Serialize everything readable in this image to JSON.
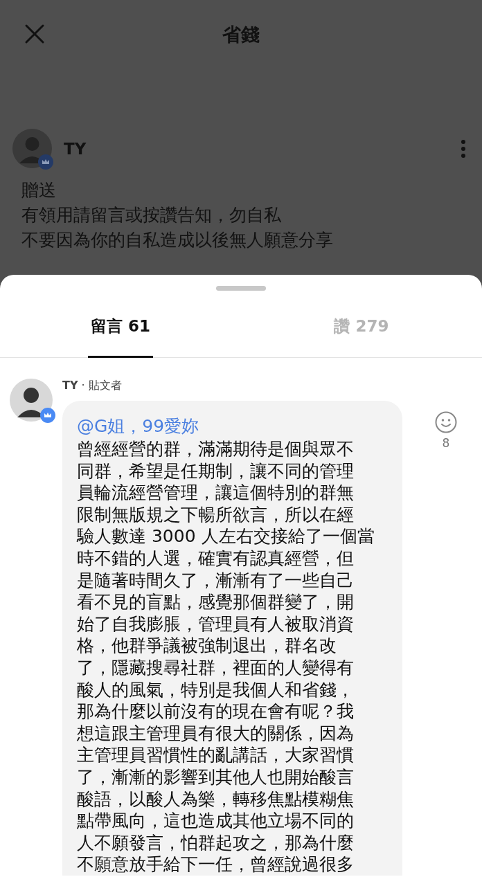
{
  "header": {
    "title": "省錢"
  },
  "post": {
    "author": "TY",
    "lines": [
      "贈送",
      "有領用請留言或按讚告知，勿自私",
      "不要因為你的自私造成以後無人願意分享"
    ]
  },
  "tabs": [
    {
      "label": "留言 61",
      "selected": true
    },
    {
      "label": "讚 279",
      "selected": false
    }
  ],
  "comments": [
    {
      "author_line": "**TY** · 貼文者",
      "mention": "@G姐，99愛妳",
      "lines": [
        "曾經經營的群，滿滿期待是個與眾不",
        "同群，希望是任期制，讓不同的管理",
        "員輪流經營管理，讓這個特別的群無",
        "限制無版規之下暢所欲言，所以在經",
        "驗人數達 3000 人左右交接給了一個當",
        "時不錯的人選，確實有認真經營，但",
        "是隨著時間久了，漸漸有了一些自己",
        "看不見的盲點，感覺那個群變了，開",
        "始了自我膨脹，管理員有人被取消資",
        "格，他群爭議被強制退出，群名改",
        "了，隱藏搜尋社群，裡面的人變得有",
        "酸人的風氣，特別是我個人和省錢，",
        "那為什麼以前沒有的現在會有呢？我",
        "想這跟主管理員有很大的關係，因為",
        "主管理員習慣性的亂講話，大家習慣",
        "了，漸漸的影響到其他人也開始酸言",
        "酸語，以酸人為樂，轉移焦點模糊焦",
        "點帶風向，這也造成其他立場不同的",
        "人不願發言，怕群起攻之，那為什麼",
        "不願意放手給下一任，曾經說過很多"
      ],
      "reaction_count": "8"
    }
  ]
}
